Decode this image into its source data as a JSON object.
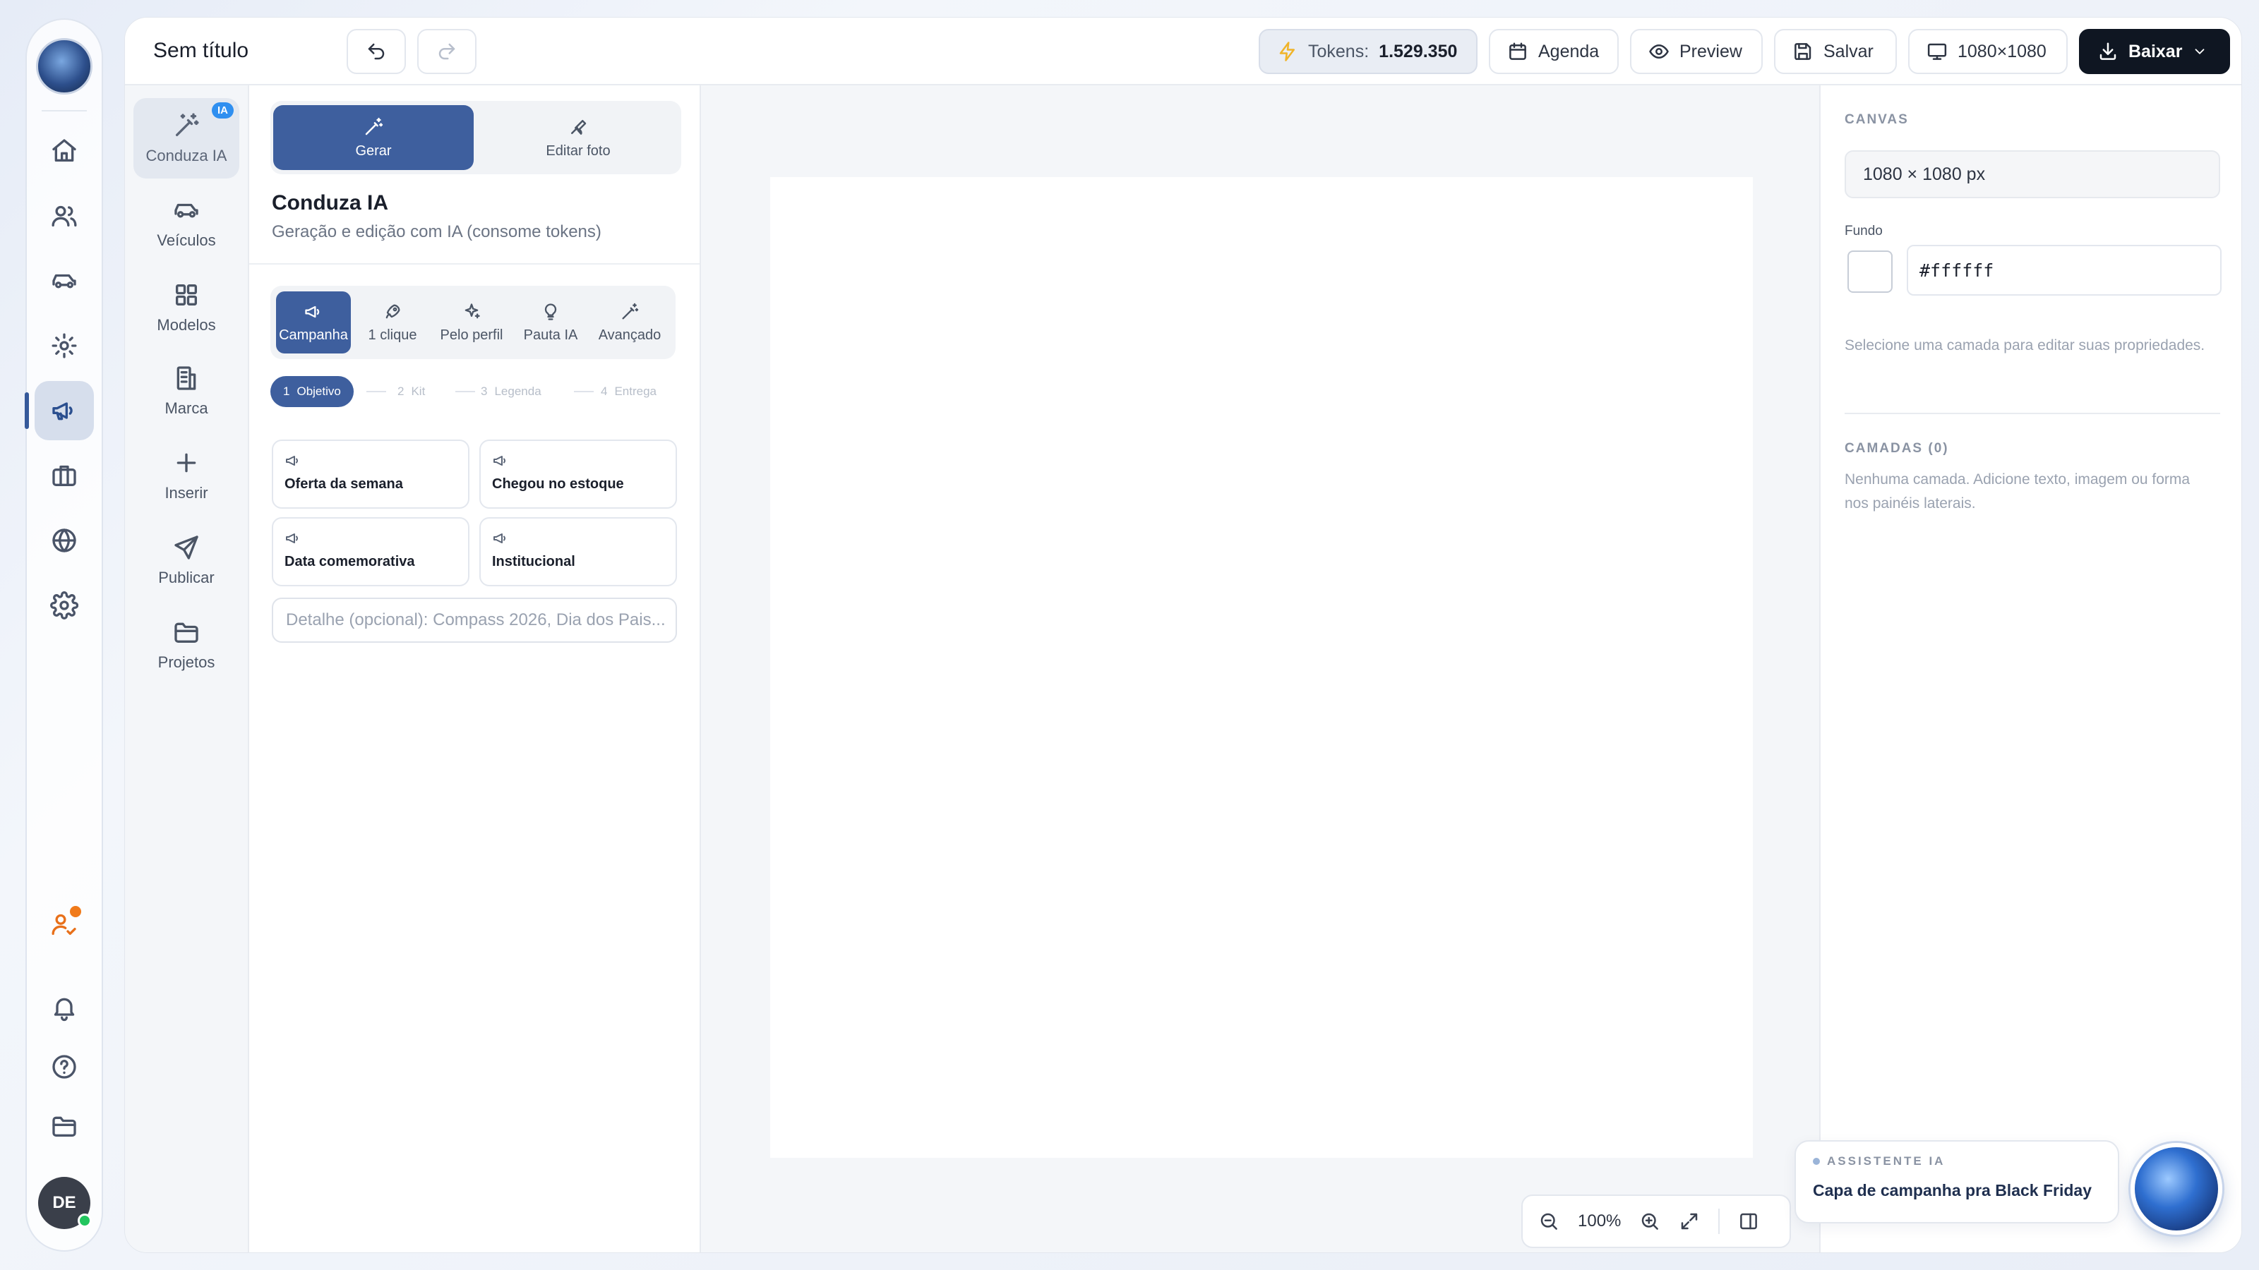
{
  "app": {
    "doc_title": "Sem título",
    "rail_avatar": "DE"
  },
  "topbar": {
    "tokens_label": "Tokens:",
    "tokens_value": "1.529.350",
    "agenda": "Agenda",
    "preview": "Preview",
    "salvar": "Salvar",
    "size": "1080×1080",
    "baixar": "Baixar"
  },
  "categories": [
    {
      "label": "Conduza IA",
      "badge": "IA",
      "icon": "magic-wand-icon"
    },
    {
      "label": "Veículos",
      "icon": "car-icon"
    },
    {
      "label": "Modelos",
      "icon": "grid-icon"
    },
    {
      "label": "Marca",
      "icon": "building-icon"
    },
    {
      "label": "Inserir",
      "icon": "plus-icon"
    },
    {
      "label": "Publicar",
      "icon": "send-icon"
    },
    {
      "label": "Projetos",
      "icon": "folder-icon"
    }
  ],
  "panel": {
    "seg_generate": "Gerar",
    "seg_edit": "Editar foto",
    "title": "Conduza IA",
    "subtitle": "Geração e edição com IA (consome tokens)",
    "modes": [
      "Campanha",
      "1 clique",
      "Pelo perfil",
      "Pauta IA",
      "Avançado"
    ],
    "steps": [
      {
        "num": "1",
        "label": "Objetivo"
      },
      {
        "num": "2",
        "label": "Kit"
      },
      {
        "num": "3",
        "label": "Legenda"
      },
      {
        "num": "4",
        "label": "Entrega"
      }
    ],
    "options": [
      "Oferta da semana",
      "Chegou no estoque",
      "Data comemorativa",
      "Institucional"
    ],
    "detail_placeholder": "Detalhe (opcional): Compass 2026, Dia dos Pais..."
  },
  "canvas": {
    "zoom": "100%"
  },
  "properties": {
    "canvas_label": "CANVAS",
    "canvas_size": "1080 × 1080 px",
    "fundo_label": "Fundo",
    "fundo_value": "#ffffff",
    "select_hint": "Selecione uma camada para editar suas propriedades.",
    "layers_label": "CAMADAS (0)",
    "layers_hint": "Nenhuma camada. Adicione texto, imagem ou forma nos painéis laterais."
  },
  "assistant": {
    "tag": "ASSISTENTE IA",
    "message": "Capa de campanha pra Black Friday"
  },
  "colors": {
    "accent": "#3e5f9e",
    "dark_button": "#0f1622",
    "badge_blue": "#2f8ff0",
    "token_bolt": "#f0b429",
    "online": "#22c55e",
    "notification": "#f07a1a"
  }
}
